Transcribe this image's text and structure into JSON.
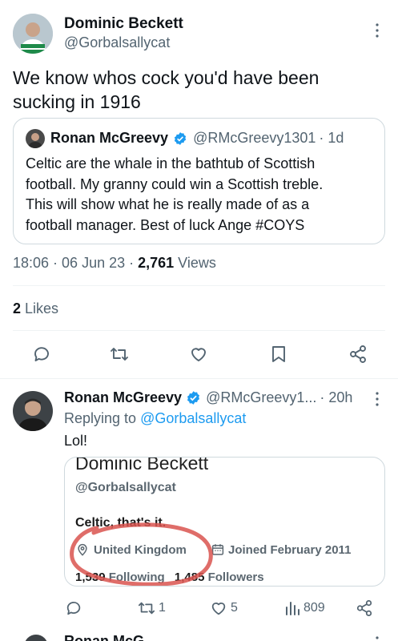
{
  "tweet": {
    "author_name": "Dominic Beckett",
    "author_handle": "@Gorbalsallycat",
    "text_line1": "We know whos cock you'd have been",
    "text_line2": "sucking in 1916",
    "quote": {
      "author_name": "Ronan McGreevy",
      "author_handle": "@RMcGreevy1301",
      "time": "· 1d",
      "line1": "Celtic are the whale in the bathtub of Scottish",
      "line2": "football. My granny could win a Scottish treble.",
      "line3": "This will show what he is really made of as a",
      "line4": "football manager. Best of luck Ange #COYS"
    },
    "meta_time": "18:06 · 06 Jun 23 · ",
    "views_count": "2,761",
    "views_label": " Views",
    "likes_count": "2",
    "likes_label": " Likes"
  },
  "reply": {
    "author_name": "Ronan McGreevy",
    "author_handle": "@RMcGreevy1...",
    "time": "· 20h",
    "replying_prefix": "Replying to ",
    "replying_handle": "@Gorbalsallycat",
    "text": "Lol!",
    "embedded_image": {
      "name": "Dominic Beckett",
      "handle": "@Gorbalsallycat",
      "bio": "Celtic, that's it.",
      "location": "United Kingdom",
      "joined": "Joined February 2011",
      "following_count": "1,539",
      "following_label": "Following",
      "followers_count": "1,485",
      "followers_label": "Followers"
    },
    "actions": {
      "retweets": "1",
      "likes": "5",
      "views": "809"
    }
  },
  "next": {
    "name_partial": "Ronan McG"
  },
  "colors": {
    "accent": "#1d9bf0",
    "text": "#0f1419",
    "muted": "#536471",
    "circle": "#d9534f"
  },
  "icons": [
    "more-icon",
    "verified-icon",
    "reply-icon",
    "retweet-icon",
    "like-icon",
    "bookmark-icon",
    "share-icon",
    "location-icon",
    "calendar-icon",
    "views-icon"
  ]
}
